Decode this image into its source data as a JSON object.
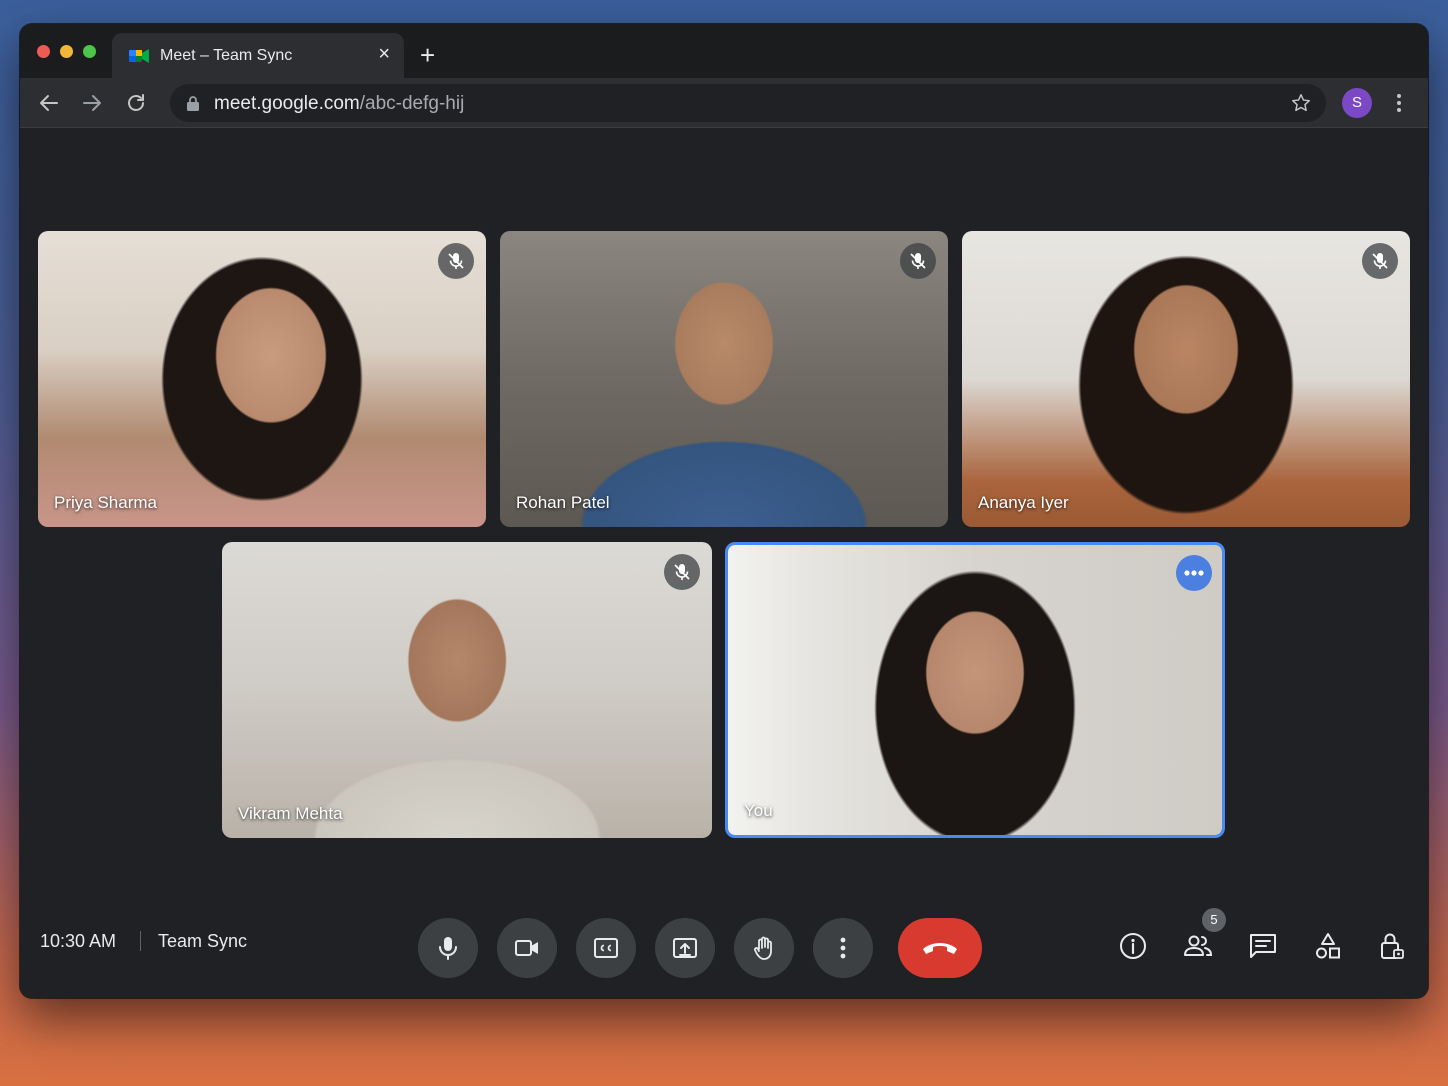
{
  "browser": {
    "tab_title": "Meet – Team Sync",
    "close_glyph": "×",
    "new_tab_glyph": "+",
    "url_host": "meet.google.com",
    "url_path": "/abc-defg-hij",
    "profile_initial": "S"
  },
  "participants": [
    {
      "name": "Priya Sharma",
      "muted": true
    },
    {
      "name": "Rohan Patel",
      "muted": true
    },
    {
      "name": "Ananya Iyer",
      "muted": true
    },
    {
      "name": "Vikram Mehta",
      "muted": true
    },
    {
      "name": "You",
      "muted": false,
      "self": true
    }
  ],
  "controls": {
    "time": "10:30 AM",
    "meeting_title": "Team Sync",
    "people_count": "5"
  },
  "icons": [
    "back-icon",
    "forward-icon",
    "reload-icon",
    "lock-icon",
    "star-icon",
    "mic-icon",
    "camera-icon",
    "captions-icon",
    "present-icon",
    "raise-hand-icon",
    "more-options-icon",
    "hang-up-icon",
    "info-icon",
    "people-icon",
    "chat-icon",
    "activities-icon",
    "host-controls-icon"
  ],
  "colors": {
    "accent": "#4a8af4",
    "hangup": "#d93a2f",
    "control_bg": "#3c4043",
    "profile": "#7b49c6"
  }
}
